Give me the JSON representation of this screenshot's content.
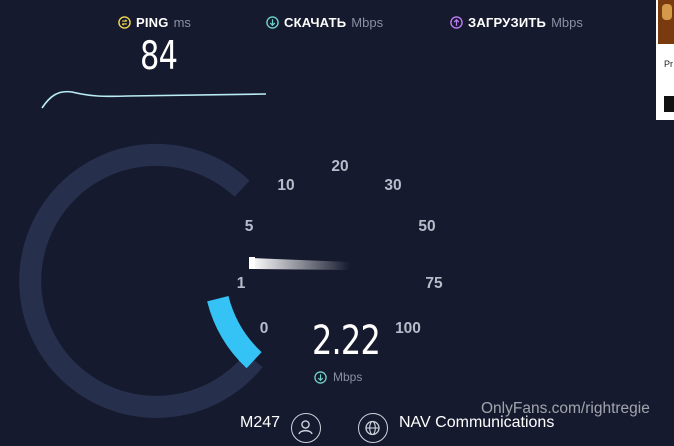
{
  "stats": {
    "ping": {
      "label": "PING",
      "unit": "ms",
      "value": "84",
      "icon": "ping-icon",
      "color": "#f2d94e"
    },
    "download": {
      "label": "СКАЧАТЬ",
      "unit": "Mbps",
      "icon": "download-arrow-icon",
      "color": "#6ed3c9"
    },
    "upload": {
      "label": "ЗАГРУЗИТЬ",
      "unit": "Mbps",
      "icon": "upload-arrow-icon",
      "color": "#c07df5"
    }
  },
  "gauge": {
    "value": "2.22",
    "unit": "Mbps",
    "scale_labels": [
      "0",
      "1",
      "5",
      "10",
      "20",
      "30",
      "50",
      "75",
      "100"
    ],
    "fill_fraction": 0.12,
    "track_color": "#26304d",
    "fill_color": "#35c3f5"
  },
  "server": {
    "isp": "M247",
    "name": "NAV Communications",
    "user_icon": "user-icon",
    "globe_icon": "globe-icon"
  },
  "watermark": "OnlyFans.com/rightregie",
  "ad": {
    "text": "Pr"
  }
}
